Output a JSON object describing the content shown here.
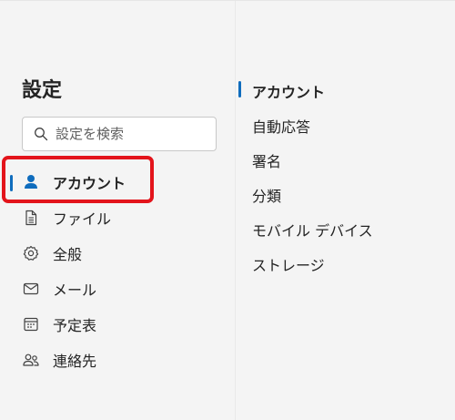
{
  "sidebar": {
    "title": "設定",
    "search": {
      "placeholder": "設定を検索",
      "value": ""
    },
    "items": [
      {
        "label": "アカウント",
        "icon": "person-icon",
        "selected": true
      },
      {
        "label": "ファイル",
        "icon": "document-icon",
        "selected": false
      },
      {
        "label": "全般",
        "icon": "gear-icon",
        "selected": false
      },
      {
        "label": "メール",
        "icon": "mail-icon",
        "selected": false
      },
      {
        "label": "予定表",
        "icon": "calendar-icon",
        "selected": false
      },
      {
        "label": "連絡先",
        "icon": "people-icon",
        "selected": false
      }
    ]
  },
  "subnav": {
    "items": [
      {
        "label": "アカウント",
        "selected": true
      },
      {
        "label": "自動応答",
        "selected": false
      },
      {
        "label": "署名",
        "selected": false
      },
      {
        "label": "分類",
        "selected": false
      },
      {
        "label": "モバイル デバイス",
        "selected": false
      },
      {
        "label": "ストレージ",
        "selected": false
      }
    ]
  },
  "colors": {
    "accent": "#0f6cbd",
    "highlight": "#e3141b",
    "background": "#f4f4f4"
  }
}
